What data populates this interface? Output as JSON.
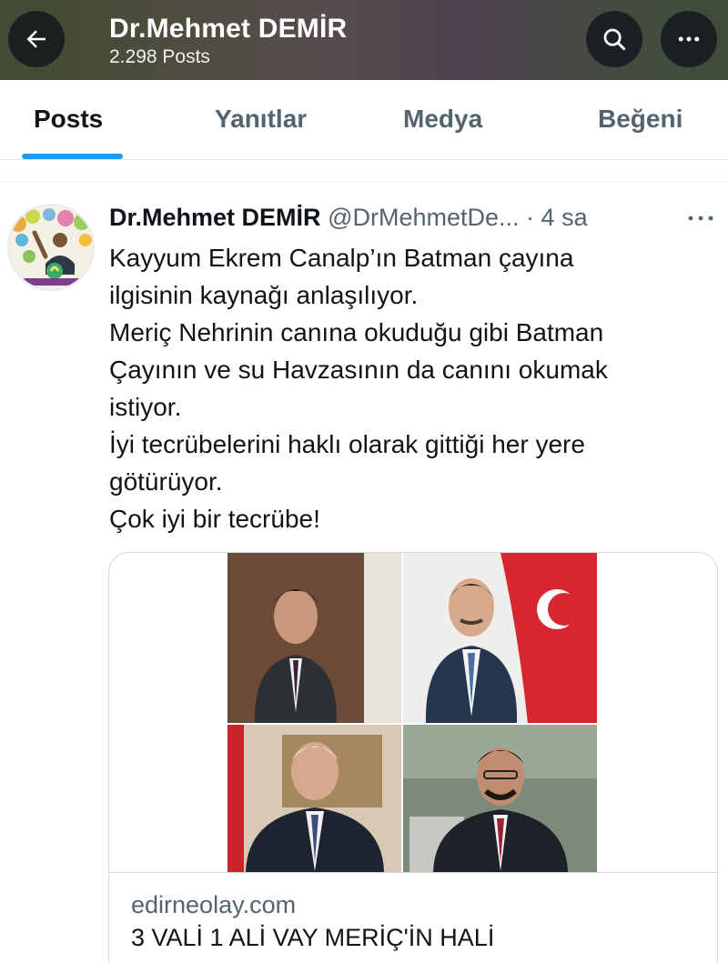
{
  "header": {
    "title": "Dr.Mehmet DEMİR",
    "post_count": "2.298 Posts",
    "back_icon": "arrow-left-icon",
    "search_icon": "search-icon",
    "more_icon": "more-horizontal-icon"
  },
  "tabs": [
    {
      "label": "Posts",
      "active": true
    },
    {
      "label": "Yanıtlar",
      "active": false
    },
    {
      "label": "Medya",
      "active": false
    },
    {
      "label": "Beğeni",
      "active": false
    }
  ],
  "post": {
    "author": "Dr.Mehmet DEMİR",
    "handle": "@DrMehmetDe...",
    "separator": "·",
    "time": "4 sa",
    "text": "Kayyum Ekrem Canalp’ın Batman çayına\nilgisinin kaynağı anlaşılıyor.\nMeriç Nehrinin canına okuduğu gibi Batman\nÇayının ve su Havzasının da canını okumak\nistiyor.\nİyi tecrübelerini haklı olarak gittiği her yere\ngötürüyor.\nÇok iyi bir tecrübe!",
    "link_card": {
      "domain": "edirneolay.com",
      "title": "3 VALİ 1 ALİ VAY MERİÇ'İN HALİ"
    }
  },
  "colors": {
    "accent": "#1d9bf0",
    "text_primary": "#0f1419",
    "text_secondary": "#536471",
    "border": "#cfd9de"
  }
}
